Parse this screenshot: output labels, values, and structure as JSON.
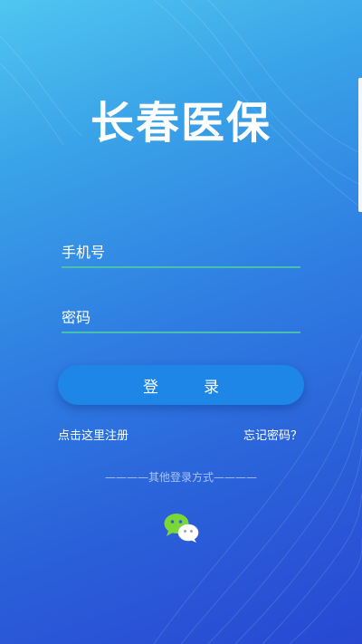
{
  "app": {
    "title": "长春医保"
  },
  "form": {
    "phone_placeholder": "手机号",
    "password_placeholder": "密码",
    "login_label": "登录"
  },
  "links": {
    "register": "点击这里注册",
    "forgot_password": "忘记密码？"
  },
  "other_login": {
    "label": "————其他登录方式————",
    "methods": [
      {
        "icon": "wechat-icon"
      }
    ]
  },
  "colors": {
    "background_top": "#4fc6f0",
    "background_bottom": "#2848d2",
    "button": "#1d86e6",
    "input_underline": "#4cc7a8",
    "wechat_green": "#7bd63a"
  }
}
